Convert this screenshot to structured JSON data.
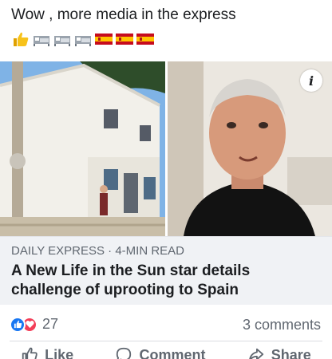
{
  "post": {
    "text": "Wow , more media in the express",
    "emojis": [
      "thumbs-up",
      "bed",
      "bed",
      "bed",
      "flag-spain",
      "flag-spain",
      "flag-spain"
    ]
  },
  "link_preview": {
    "source": "DAILY EXPRESS",
    "separator": " · ",
    "read_time": "4-MIN READ",
    "headline": "A New Life in the Sun star details challenge of uprooting to Spain",
    "info_icon_label": "i"
  },
  "stats": {
    "reaction_count": "27",
    "comments": "3 comments"
  },
  "actions": {
    "like": "Like",
    "comment": "Comment",
    "share": "Share"
  },
  "colors": {
    "like_blue": "#1877f2",
    "love_red": "#f33e58",
    "preview_bg": "#f0f2f5",
    "muted_text": "#606770"
  }
}
